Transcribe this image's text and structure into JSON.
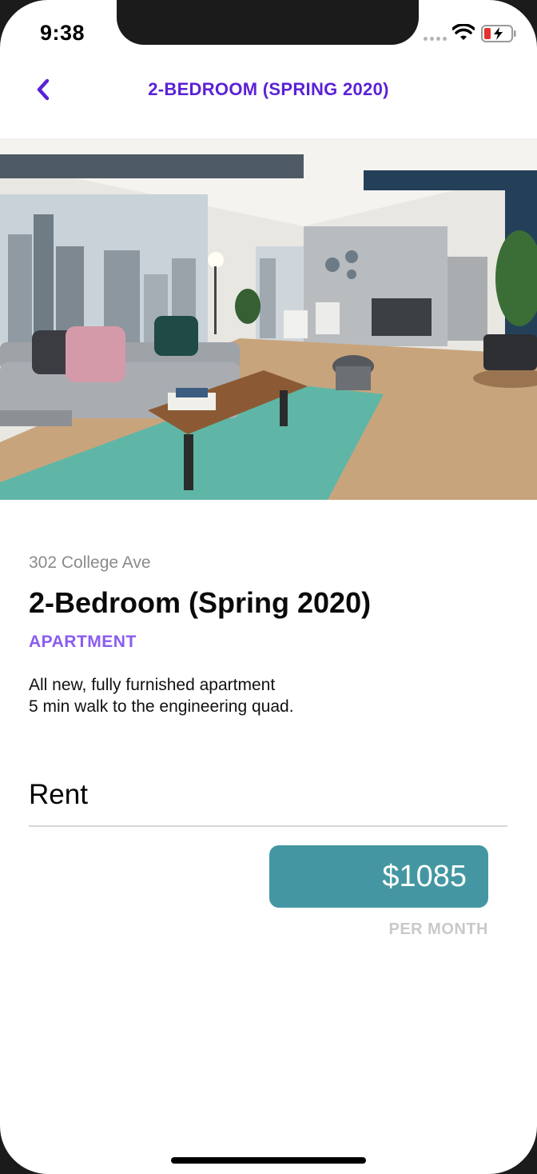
{
  "status_bar": {
    "time": "9:38"
  },
  "nav": {
    "title": "2-BEDROOM (SPRING 2020)",
    "back_icon": "chevron-left-icon"
  },
  "listing": {
    "address": "302 College Ave",
    "title": "2-Bedroom (Spring 2020)",
    "type": "APARTMENT",
    "description_line1": "All new, fully furnished apartment",
    "description_line2": "5 min walk to the engineering quad.",
    "image": "living-room-photo"
  },
  "rent": {
    "heading": "Rent",
    "price": "$1085",
    "period": "PER MONTH"
  },
  "colors": {
    "accent": "#5b21d6",
    "type_label": "#8a5cf0",
    "price_badge": "#4497a2"
  }
}
